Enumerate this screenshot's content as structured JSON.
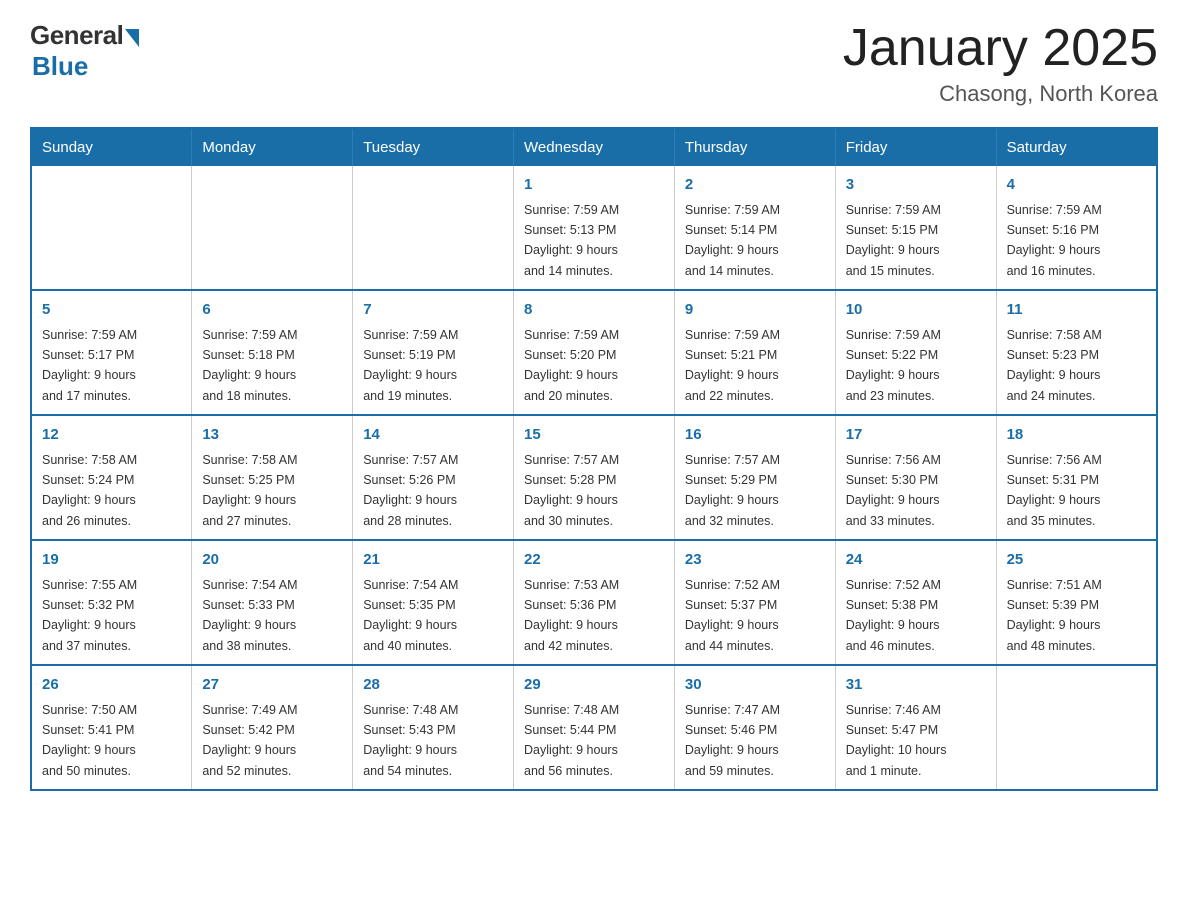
{
  "header": {
    "logo_general": "General",
    "logo_blue": "Blue",
    "title": "January 2025",
    "subtitle": "Chasong, North Korea"
  },
  "days_of_week": [
    "Sunday",
    "Monday",
    "Tuesday",
    "Wednesday",
    "Thursday",
    "Friday",
    "Saturday"
  ],
  "weeks": [
    [
      {
        "day": "",
        "info": ""
      },
      {
        "day": "",
        "info": ""
      },
      {
        "day": "",
        "info": ""
      },
      {
        "day": "1",
        "info": "Sunrise: 7:59 AM\nSunset: 5:13 PM\nDaylight: 9 hours\nand 14 minutes."
      },
      {
        "day": "2",
        "info": "Sunrise: 7:59 AM\nSunset: 5:14 PM\nDaylight: 9 hours\nand 14 minutes."
      },
      {
        "day": "3",
        "info": "Sunrise: 7:59 AM\nSunset: 5:15 PM\nDaylight: 9 hours\nand 15 minutes."
      },
      {
        "day": "4",
        "info": "Sunrise: 7:59 AM\nSunset: 5:16 PM\nDaylight: 9 hours\nand 16 minutes."
      }
    ],
    [
      {
        "day": "5",
        "info": "Sunrise: 7:59 AM\nSunset: 5:17 PM\nDaylight: 9 hours\nand 17 minutes."
      },
      {
        "day": "6",
        "info": "Sunrise: 7:59 AM\nSunset: 5:18 PM\nDaylight: 9 hours\nand 18 minutes."
      },
      {
        "day": "7",
        "info": "Sunrise: 7:59 AM\nSunset: 5:19 PM\nDaylight: 9 hours\nand 19 minutes."
      },
      {
        "day": "8",
        "info": "Sunrise: 7:59 AM\nSunset: 5:20 PM\nDaylight: 9 hours\nand 20 minutes."
      },
      {
        "day": "9",
        "info": "Sunrise: 7:59 AM\nSunset: 5:21 PM\nDaylight: 9 hours\nand 22 minutes."
      },
      {
        "day": "10",
        "info": "Sunrise: 7:59 AM\nSunset: 5:22 PM\nDaylight: 9 hours\nand 23 minutes."
      },
      {
        "day": "11",
        "info": "Sunrise: 7:58 AM\nSunset: 5:23 PM\nDaylight: 9 hours\nand 24 minutes."
      }
    ],
    [
      {
        "day": "12",
        "info": "Sunrise: 7:58 AM\nSunset: 5:24 PM\nDaylight: 9 hours\nand 26 minutes."
      },
      {
        "day": "13",
        "info": "Sunrise: 7:58 AM\nSunset: 5:25 PM\nDaylight: 9 hours\nand 27 minutes."
      },
      {
        "day": "14",
        "info": "Sunrise: 7:57 AM\nSunset: 5:26 PM\nDaylight: 9 hours\nand 28 minutes."
      },
      {
        "day": "15",
        "info": "Sunrise: 7:57 AM\nSunset: 5:28 PM\nDaylight: 9 hours\nand 30 minutes."
      },
      {
        "day": "16",
        "info": "Sunrise: 7:57 AM\nSunset: 5:29 PM\nDaylight: 9 hours\nand 32 minutes."
      },
      {
        "day": "17",
        "info": "Sunrise: 7:56 AM\nSunset: 5:30 PM\nDaylight: 9 hours\nand 33 minutes."
      },
      {
        "day": "18",
        "info": "Sunrise: 7:56 AM\nSunset: 5:31 PM\nDaylight: 9 hours\nand 35 minutes."
      }
    ],
    [
      {
        "day": "19",
        "info": "Sunrise: 7:55 AM\nSunset: 5:32 PM\nDaylight: 9 hours\nand 37 minutes."
      },
      {
        "day": "20",
        "info": "Sunrise: 7:54 AM\nSunset: 5:33 PM\nDaylight: 9 hours\nand 38 minutes."
      },
      {
        "day": "21",
        "info": "Sunrise: 7:54 AM\nSunset: 5:35 PM\nDaylight: 9 hours\nand 40 minutes."
      },
      {
        "day": "22",
        "info": "Sunrise: 7:53 AM\nSunset: 5:36 PM\nDaylight: 9 hours\nand 42 minutes."
      },
      {
        "day": "23",
        "info": "Sunrise: 7:52 AM\nSunset: 5:37 PM\nDaylight: 9 hours\nand 44 minutes."
      },
      {
        "day": "24",
        "info": "Sunrise: 7:52 AM\nSunset: 5:38 PM\nDaylight: 9 hours\nand 46 minutes."
      },
      {
        "day": "25",
        "info": "Sunrise: 7:51 AM\nSunset: 5:39 PM\nDaylight: 9 hours\nand 48 minutes."
      }
    ],
    [
      {
        "day": "26",
        "info": "Sunrise: 7:50 AM\nSunset: 5:41 PM\nDaylight: 9 hours\nand 50 minutes."
      },
      {
        "day": "27",
        "info": "Sunrise: 7:49 AM\nSunset: 5:42 PM\nDaylight: 9 hours\nand 52 minutes."
      },
      {
        "day": "28",
        "info": "Sunrise: 7:48 AM\nSunset: 5:43 PM\nDaylight: 9 hours\nand 54 minutes."
      },
      {
        "day": "29",
        "info": "Sunrise: 7:48 AM\nSunset: 5:44 PM\nDaylight: 9 hours\nand 56 minutes."
      },
      {
        "day": "30",
        "info": "Sunrise: 7:47 AM\nSunset: 5:46 PM\nDaylight: 9 hours\nand 59 minutes."
      },
      {
        "day": "31",
        "info": "Sunrise: 7:46 AM\nSunset: 5:47 PM\nDaylight: 10 hours\nand 1 minute."
      },
      {
        "day": "",
        "info": ""
      }
    ]
  ]
}
